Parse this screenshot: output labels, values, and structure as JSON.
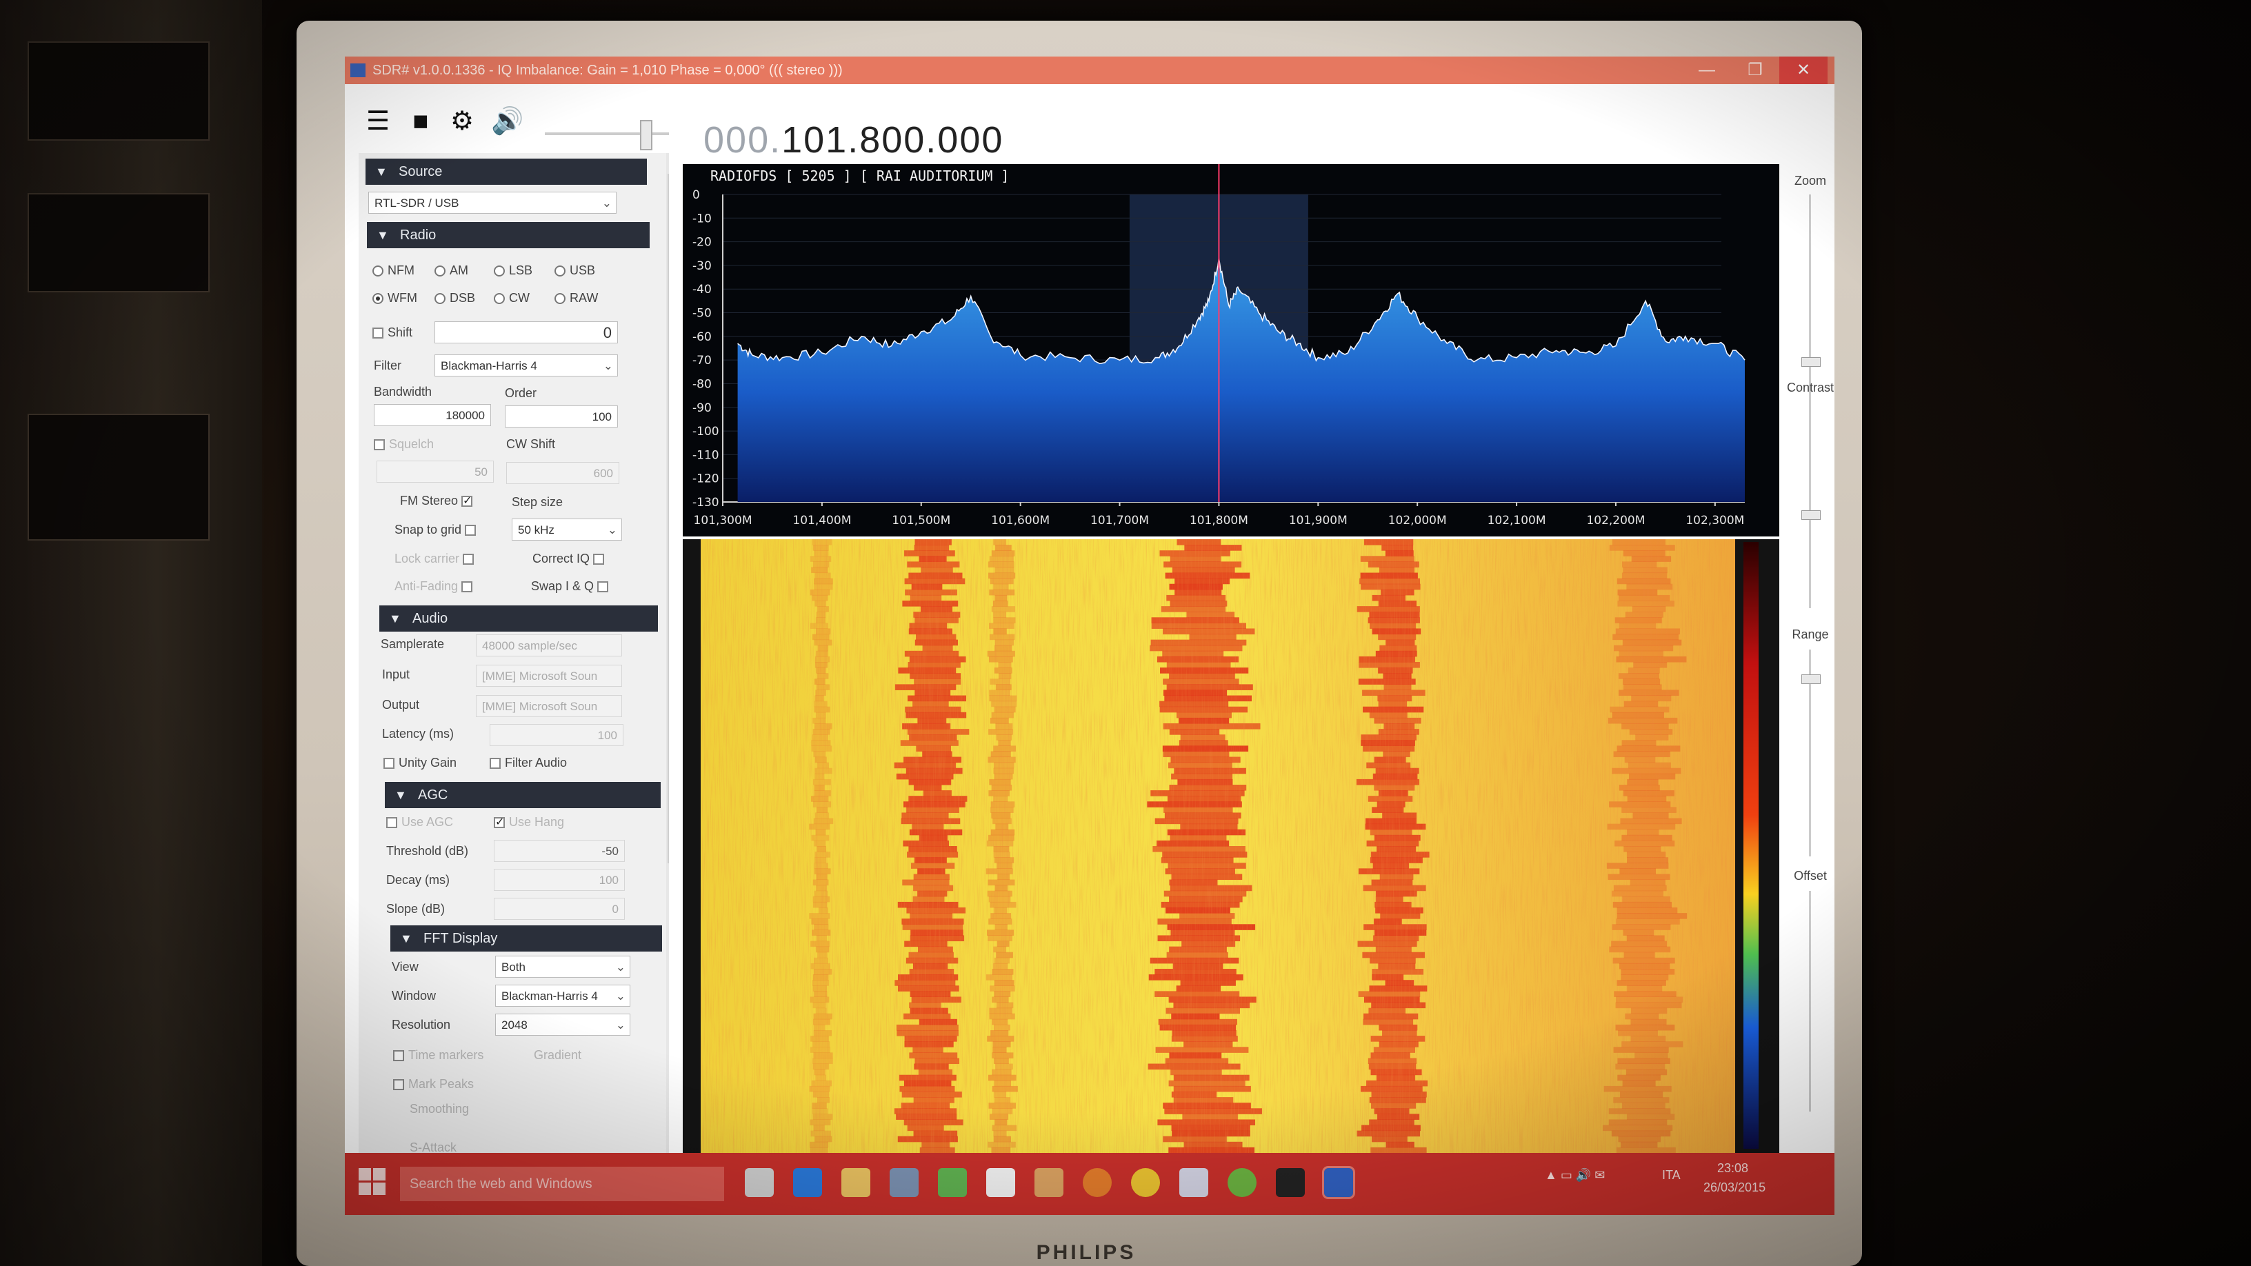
{
  "window": {
    "title": "SDR# v1.0.0.1336 - IQ Imbalance: Gain = 1,010 Phase = 0,000° ((( stereo )))",
    "buttons": [
      "—",
      "❐",
      "✕"
    ]
  },
  "toolbar": {
    "icons": [
      "menu-icon",
      "stop-icon",
      "gear-icon",
      "speaker-icon"
    ],
    "frequency_prefix": "000.",
    "frequency_main": "101.800.000"
  },
  "source": {
    "header": "Source",
    "device": "RTL-SDR / USB"
  },
  "radio": {
    "header": "Radio",
    "modes_row1": [
      "NFM",
      "AM",
      "LSB",
      "USB"
    ],
    "modes_row2": [
      "WFM",
      "DSB",
      "CW",
      "RAW"
    ],
    "selected_mode": "WFM",
    "shift_label": "Shift",
    "shift_value": "0",
    "filter_label": "Filter",
    "filter_value": "Blackman-Harris 4",
    "bandwidth_label": "Bandwidth",
    "bandwidth_value": "180000",
    "order_label": "Order",
    "order_value": "100",
    "squelch_label": "Squelch",
    "squelch_value": "50",
    "cwshift_label": "CW Shift",
    "cwshift_value": "600",
    "fmstereo_label": "FM Stereo",
    "stepsize_label": "Step size",
    "snaptogrid_label": "Snap to grid",
    "stepsize_value": "50 kHz",
    "lockcarrier_label": "Lock carrier",
    "correctiq_label": "Correct IQ",
    "antifading_label": "Anti-Fading",
    "swapiq_label": "Swap I & Q"
  },
  "audio": {
    "header": "Audio",
    "samplerate_label": "Samplerate",
    "samplerate_value": "48000 sample/sec",
    "input_label": "Input",
    "input_value": "[MME] Microsoft Soun",
    "output_label": "Output",
    "output_value": "[MME] Microsoft Soun",
    "latency_label": "Latency (ms)",
    "latency_value": "100",
    "unitygain_label": "Unity Gain",
    "filteraudio_label": "Filter Audio"
  },
  "agc": {
    "header": "AGC",
    "useagc_label": "Use AGC",
    "usehang_label": "Use Hang",
    "threshold_label": "Threshold (dB)",
    "threshold_value": "-50",
    "decay_label": "Decay (ms)",
    "decay_value": "100",
    "slope_label": "Slope (dB)",
    "slope_value": "0"
  },
  "fft": {
    "header": "FFT Display",
    "view_label": "View",
    "view_value": "Both",
    "window_label": "Window",
    "window_value": "Blackman-Harris 4",
    "resolution_label": "Resolution",
    "resolution_value": "2048",
    "timemarkers_label": "Time markers",
    "gradient_label": "Gradient",
    "markpeaks_label": "Mark Peaks",
    "smoothing_label": "Smoothing",
    "sattack_label": "S-Attack"
  },
  "right_panel": {
    "zoom_label": "Zoom",
    "contrast_label": "Contrast",
    "range_label": "Range",
    "offset_label": "Offset"
  },
  "chart_data": {
    "type": "line",
    "station_label": "RADIOFDS [ 5205 ]  [ RAI AUDITORIUM ]",
    "xlabel": "",
    "ylabel": "",
    "x_ticks": [
      "101,300M",
      "101,400M",
      "101,500M",
      "101,600M",
      "101,700M",
      "101,800M",
      "101,900M",
      "102,000M",
      "102,100M",
      "102,200M",
      "102,300M"
    ],
    "y_ticks": [
      "0",
      "-10",
      "-20",
      "-30",
      "-40",
      "-50",
      "-60",
      "-70",
      "-80",
      "-90",
      "-100",
      "-110",
      "-120",
      "-130"
    ],
    "xlim": [
      101.3,
      102.33
    ],
    "ylim": [
      -130,
      0
    ],
    "tuned_mhz": 101.8,
    "filter_band_mhz": [
      101.71,
      101.89
    ],
    "series": [
      {
        "x": [
          101.315,
          101.33,
          101.36,
          101.4,
          101.44,
          101.47,
          101.5,
          101.53,
          101.55,
          101.57,
          101.6,
          101.65,
          101.7,
          101.74,
          101.76,
          101.78,
          101.79,
          101.8,
          101.81,
          101.82,
          101.84,
          101.86,
          101.88,
          101.9,
          101.93,
          101.96,
          101.98,
          102.0,
          102.03,
          102.06,
          102.1,
          102.14,
          102.17,
          102.2,
          102.23,
          102.25,
          102.27,
          102.3,
          102.33
        ],
        "y": [
          -63,
          -68,
          -69,
          -67,
          -60,
          -64,
          -58,
          -53,
          -43,
          -60,
          -68,
          -69,
          -70,
          -69,
          -64,
          -52,
          -45,
          -27,
          -47,
          -40,
          -50,
          -58,
          -63,
          -69,
          -67,
          -53,
          -42,
          -52,
          -63,
          -70,
          -69,
          -66,
          -67,
          -64,
          -45,
          -62,
          -60,
          -63,
          -70
        ]
      }
    ]
  },
  "taskbar": {
    "search_placeholder": "Search the web and Windows",
    "tray_lang": "ITA",
    "tray_time": "23:08",
    "tray_date": "26/03/2015"
  },
  "colors": {
    "title_bar": "#e67860",
    "taskbar": "#c62f2a",
    "spectrum_fill_top": "#3aa0e8",
    "spectrum_fill_bottom": "#0a1e66",
    "tuned_line": "#ff3b6b",
    "waterfall_bg": "#f2dc3c",
    "waterfall_hot": "#e2381a"
  },
  "monitor": {
    "brand": "PHILIPS"
  }
}
